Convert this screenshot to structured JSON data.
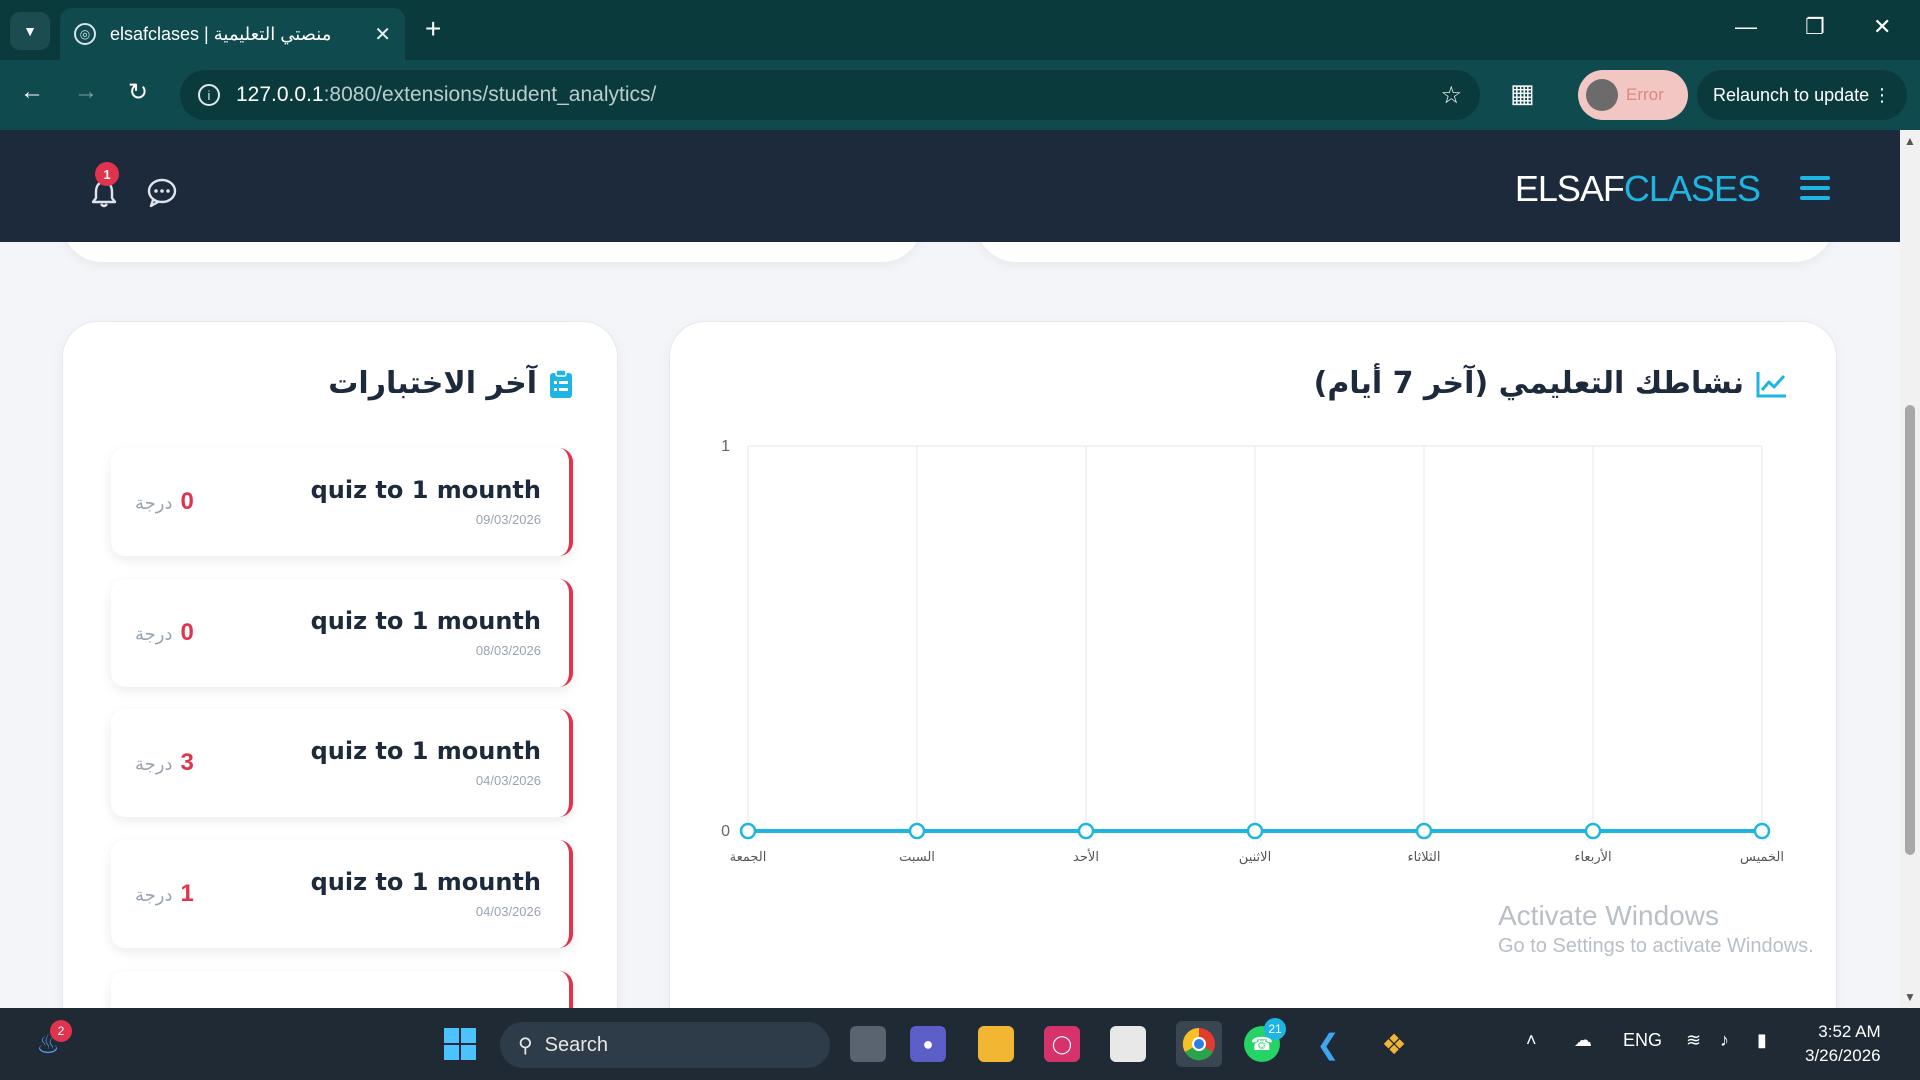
{
  "browser": {
    "tab_title": "elsafclases | منصتي التعليمية",
    "url_host": "127.0.0.1",
    "url_path": ":8080/extensions/student_analytics/",
    "profile_status": "Error",
    "relaunch_label": "Relaunch to update"
  },
  "app": {
    "brand_main": "ELSAF",
    "brand_accent": "CLASES",
    "notification_count": "1",
    "accent_color": "#1fb5e3",
    "header_color": "#1d2a3c",
    "danger_color": "#e0334d"
  },
  "quizzes": {
    "title": "آخر الاختبارات",
    "unit": "درجة",
    "items": [
      {
        "name": "quiz to 1 mounth",
        "date": "09/03/2026",
        "score": "0"
      },
      {
        "name": "quiz to 1 mounth",
        "date": "08/03/2026",
        "score": "0"
      },
      {
        "name": "quiz to 1 mounth",
        "date": "04/03/2026",
        "score": "3"
      },
      {
        "name": "quiz to 1 mounth",
        "date": "04/03/2026",
        "score": "1"
      }
    ]
  },
  "activity": {
    "title": "نشاطك التعليمي (آخر 7 أيام)"
  },
  "chart_data": {
    "type": "line",
    "title": "نشاطك التعليمي (آخر 7 أيام)",
    "categories": [
      "الجمعة",
      "السبت",
      "الأحد",
      "الاثنين",
      "الثلاثاء",
      "الأربعاء",
      "الخميس"
    ],
    "series": [
      {
        "values": [
          0,
          0,
          0,
          0,
          0,
          0,
          0
        ]
      }
    ],
    "ylim": [
      0,
      1
    ],
    "yticks": [
      "0",
      "1"
    ],
    "grid": true,
    "color": "#1fb5e3"
  },
  "os": {
    "watermark_title": "Activate Windows",
    "watermark_sub": "Go to Settings to activate Windows.",
    "search_label": "Search",
    "language": "ENG",
    "time": "3:52 AM",
    "date": "3/26/2026",
    "weather_badge": "2",
    "whatsapp_badge": "21"
  }
}
